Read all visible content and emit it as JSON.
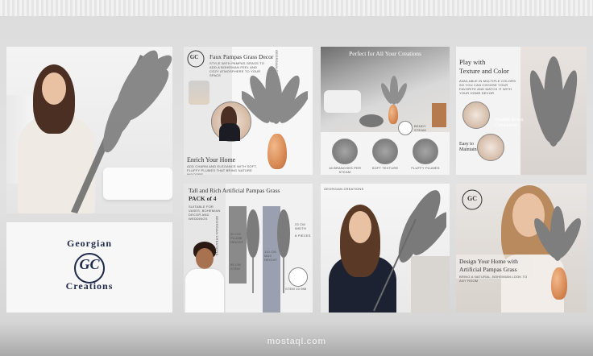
{
  "brand": {
    "line1": "Georgian",
    "monogram": "GC",
    "line2": "Creations",
    "small": "GEORGIAN CREATIONS"
  },
  "tile_decor": {
    "title": "Faux Pampas Grass Decor",
    "desc": "STYLE WITH PAMPAS GRASS TO ADD A BOHEMIAN FEEL AND COZY ATMOSPHERE TO YOUR SPACE",
    "side_label": "GEORGIAN CREATIONS",
    "subtitle": "Enrich Your Home",
    "sub_desc": "ADD CHARM AND ELEGANCE WITH SOFT, FLUFFY PLUMES THAT BRING NATURE INDOORS"
  },
  "tile_creations": {
    "title": "Perfect for All Your Creations",
    "captions": [
      "18 BRANCHES PER STEAM",
      "SOFT TEXTURE",
      "FLUFFY PLUMES"
    ],
    "badge": "BENDY STEAM"
  },
  "tile_texture": {
    "title_line1": "Play with",
    "title_line2": "Texture and Color",
    "desc": "AVAILABLE IN MULTIPLE COLORS SO YOU CAN CHOOSE YOUR FAVORITE AND MATCH IT WITH YOUR HOME DECOR",
    "label1_line1": "Durable Room",
    "label1_line2": "Companion",
    "label2_line1": "Easy to",
    "label2_line2": "Maintain"
  },
  "tile_pack": {
    "title": "Tall and Rich Artificial Pampas Grass",
    "pack": "PACK of 4",
    "note": "SUITABLE FOR VASES, BOHEMIAN DECOR AND WEDDINGS",
    "dims": [
      "20 CM PLUME HEIGHT",
      "110 CM MAX HEIGHT",
      "23 CM WIDTH",
      "55 CM STEM",
      "8 PIECES",
      "STEM 10 MM"
    ]
  },
  "tile_design": {
    "title_line1": "Design Your Home with",
    "title_line2": "Artificial Pampas Grass",
    "desc": "BRING A NATURAL, BOHEMIAN LOOK TO ANY ROOM"
  },
  "watermark": {
    "text": "mostaql.com"
  },
  "colors": {
    "navy": "#1f2a4a",
    "plume_gray": "#7f7f7f",
    "vase": "#d88a55"
  }
}
